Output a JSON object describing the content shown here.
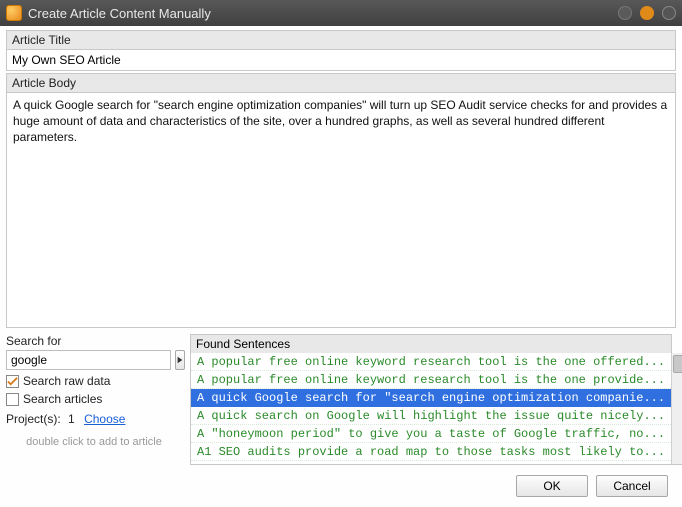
{
  "titlebar": {
    "title": "Create Article Content Manually"
  },
  "labels": {
    "article_title": "Article Title",
    "article_body": "Article Body",
    "search_for": "Search for",
    "search_raw": "Search raw data",
    "search_articles": "Search articles",
    "projects_prefix": "Project(s):",
    "projects_count": "1",
    "choose": "Choose",
    "hint": "double click to add to article",
    "found": "Found Sentences"
  },
  "fields": {
    "title_value": "My Own SEO Article",
    "body_value": "A quick Google search for \"search engine optimization companies\" will turn up SEO Audit service checks for and provides a huge amount of data and characteristics of the site, over a hundred graphs, as well as several hundred different parameters.",
    "search_value": "google"
  },
  "checks": {
    "raw": true,
    "articles": false
  },
  "found_sentences": [
    {
      "text": "A popular free online keyword research tool is the one offered...",
      "selected": false
    },
    {
      "text": "A popular free online keyword research tool is the one provide...",
      "selected": false
    },
    {
      "text": "A quick Google search for \"search engine optimization companie...",
      "selected": true
    },
    {
      "text": "A quick search on Google will highlight the issue quite nicely...",
      "selected": false
    },
    {
      "text": "A \"honeymoon period\" to give you a taste of Google traffic, no...",
      "selected": false
    },
    {
      "text": "A1 SEO audits provide a road map to those tasks most likely to...",
      "selected": false
    }
  ],
  "buttons": {
    "ok": "OK",
    "cancel": "Cancel"
  }
}
